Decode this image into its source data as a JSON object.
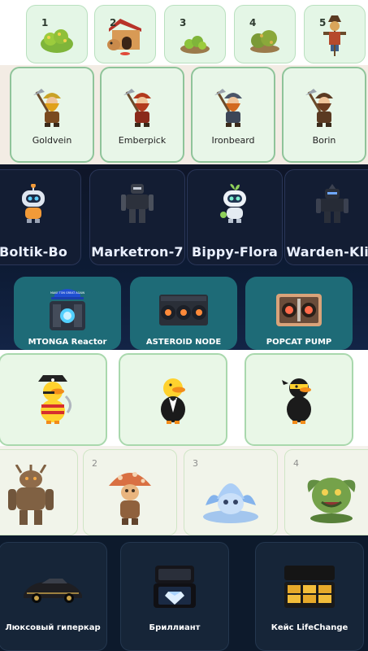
{
  "farm_slots": {
    "items": [
      {
        "num": "1",
        "icon": "bush-icon"
      },
      {
        "num": "2",
        "icon": "doghouse-icon"
      },
      {
        "num": "3",
        "icon": "sprout-icon"
      },
      {
        "num": "4",
        "icon": "shrub-icon"
      },
      {
        "num": "5",
        "icon": "scarecrow-icon"
      }
    ]
  },
  "dwarves": {
    "items": [
      {
        "label": "Goldvein",
        "beard": "#e0a11a",
        "helmet": "#c9a227"
      },
      {
        "label": "Emberpick",
        "beard": "#b23a1e",
        "helmet": "#b23a1e"
      },
      {
        "label": "Ironbeard",
        "beard": "#d2691e",
        "helmet": "#4a5568"
      },
      {
        "label": "Borin",
        "beard": "#6b3b1f",
        "helmet": "#5b3a22"
      }
    ]
  },
  "robots": {
    "items": [
      {
        "label": "Boltik-Bo",
        "icon": "robot-boltik-icon"
      },
      {
        "label": "Marketron-7",
        "icon": "robot-marketron-icon"
      },
      {
        "label": "Bippy-Flora",
        "icon": "robot-bippy-icon"
      },
      {
        "label": "Warden-Klin",
        "icon": "robot-warden-icon"
      }
    ]
  },
  "machines": {
    "items": [
      {
        "label": "MTONGA Reactor",
        "icon": "reactor-icon",
        "cap_text": "MAKE TON GREAT AGAIN"
      },
      {
        "label": "ASTEROID NODE",
        "icon": "mining-rig-icon"
      },
      {
        "label": "POPCAT PUMP",
        "icon": "pump-rig-icon"
      }
    ]
  },
  "ducks": {
    "items": [
      {
        "icon": "pirate-duck-icon"
      },
      {
        "icon": "tuxedo-duck-icon"
      },
      {
        "icon": "ninja-duck-icon"
      }
    ]
  },
  "creatures": {
    "items": [
      {
        "num": "",
        "icon": "tree-golem-icon"
      },
      {
        "num": "2",
        "icon": "mushroom-creature-icon"
      },
      {
        "num": "3",
        "icon": "lotus-creature-icon"
      },
      {
        "num": "4",
        "icon": "plant-monster-icon"
      }
    ]
  },
  "luxury": {
    "items": [
      {
        "label": "Люксовый гиперкар",
        "icon": "hypercar-icon"
      },
      {
        "label": "Бриллиант",
        "icon": "diamond-box-icon"
      },
      {
        "label": "Кейс LifeChange",
        "icon": "gold-case-icon"
      }
    ]
  },
  "colors": {
    "dark_bg": "#0f1628",
    "machine_bg": "#1e6b77",
    "mint_card": "#e8f6e8",
    "mint_border": "#8fc49a"
  }
}
